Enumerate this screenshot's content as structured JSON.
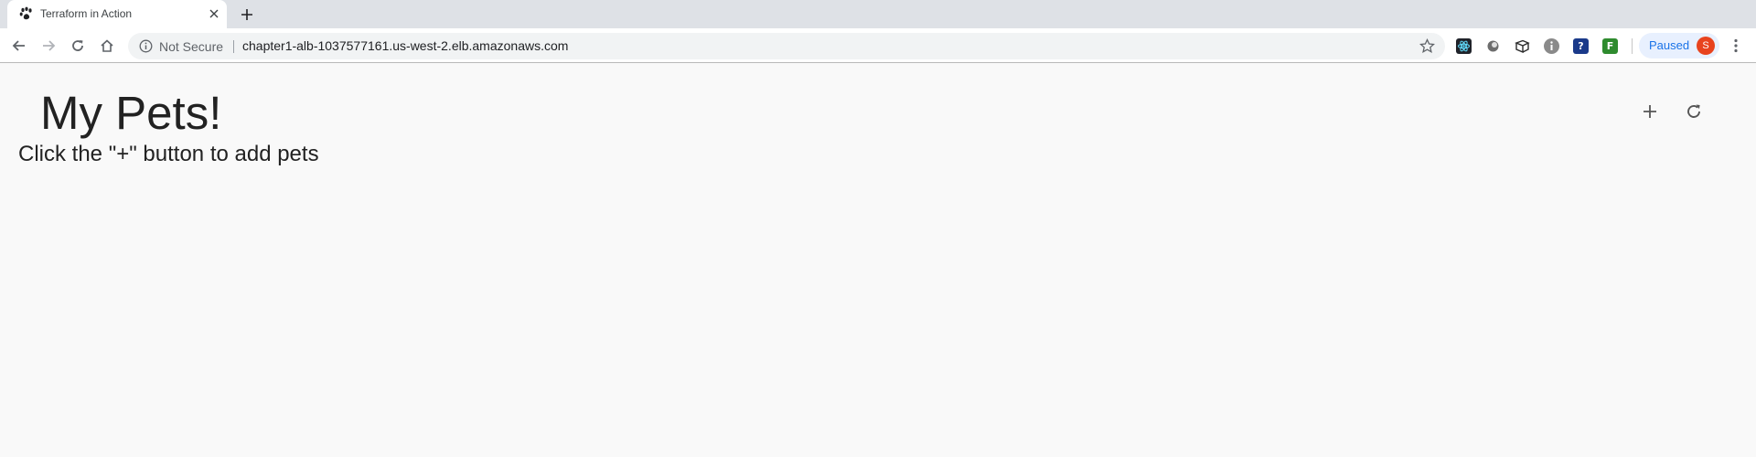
{
  "browser": {
    "tab": {
      "title": "Terraform in Action",
      "favicon": "paw-icon"
    },
    "toolbar": {
      "security_label": "Not Secure",
      "url": "chapter1-alb-1037577161.us-west-2.elb.amazonaws.com",
      "profile_label": "Paused",
      "profile_initial": "S",
      "extensions": [
        {
          "name": "react-devtools-icon",
          "color": "#20232a"
        },
        {
          "name": "circle-extension-icon",
          "color": "#6d6d6d"
        },
        {
          "name": "boxes-extension-icon",
          "color": "#3b3b3b"
        },
        {
          "name": "info-extension-icon",
          "color": "#8a8a8a"
        },
        {
          "name": "question-extension-icon",
          "color": "#1a3a8a",
          "glyph": "?"
        },
        {
          "name": "f-extension-icon",
          "color": "#2e8b2e",
          "glyph": "F"
        }
      ]
    }
  },
  "page": {
    "title": "My Pets!",
    "hint": "Click the \"+\" button to add pets",
    "add_button": "add-icon",
    "refresh_button": "refresh-icon"
  },
  "colors": {
    "accent": "#1a73e8",
    "avatar": "#e8431e",
    "text": "#222222"
  }
}
